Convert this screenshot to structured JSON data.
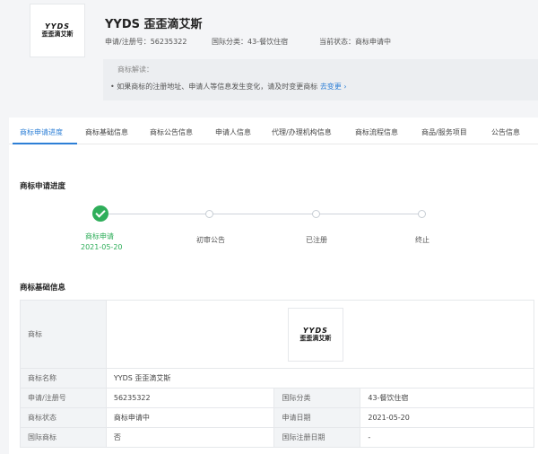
{
  "header": {
    "logo": {
      "line1": "YYDS",
      "line2": "歪歪滴艾斯"
    },
    "title": "YYDS 歪歪滴艾斯",
    "reg_no": "申请/注册号：56235322",
    "intl_class": "国际分类：43-餐饮住宿",
    "status": "当前状态：商标申请中"
  },
  "notice": {
    "title": "商标解读：",
    "text": "• 如果商标的注册地址、申请人等信息发生变化，请及时变更商标",
    "link": "去变更 ›"
  },
  "tabs": [
    {
      "label": "商标申请进度",
      "active": true
    },
    {
      "label": "商标基础信息",
      "active": false
    },
    {
      "label": "商标公告信息",
      "active": false
    },
    {
      "label": "申请人信息",
      "active": false
    },
    {
      "label": "代理/办理机构信息",
      "active": false
    },
    {
      "label": "商标流程信息",
      "active": false
    },
    {
      "label": "商品/服务项目",
      "active": false
    },
    {
      "label": "公告信息",
      "active": false
    }
  ],
  "progress": {
    "title": "商标申请进度",
    "steps": [
      {
        "label": "商标申请",
        "date": "2021-05-20",
        "done": true
      },
      {
        "label": "初审公告",
        "done": false
      },
      {
        "label": "已注册",
        "done": false
      },
      {
        "label": "终止",
        "done": false
      }
    ]
  },
  "basic_info": {
    "title": "商标基础信息",
    "trademark_label": "商标",
    "name_label": "商标名称",
    "name_value": "YYDS 歪歪滴艾斯",
    "rows": [
      {
        "k1": "申请/注册号",
        "v1": "56235322",
        "k2": "国际分类",
        "v2": "43-餐饮住宿"
      },
      {
        "k1": "商标状态",
        "v1": "商标申请中",
        "k2": "申请日期",
        "v2": "2021-05-20"
      },
      {
        "k1": "国际商标",
        "v1": "否",
        "k2": "国际注册日期",
        "v2": "-"
      }
    ]
  },
  "colors": {
    "accent": "#2d7fd6",
    "success": "#2fae5a"
  }
}
